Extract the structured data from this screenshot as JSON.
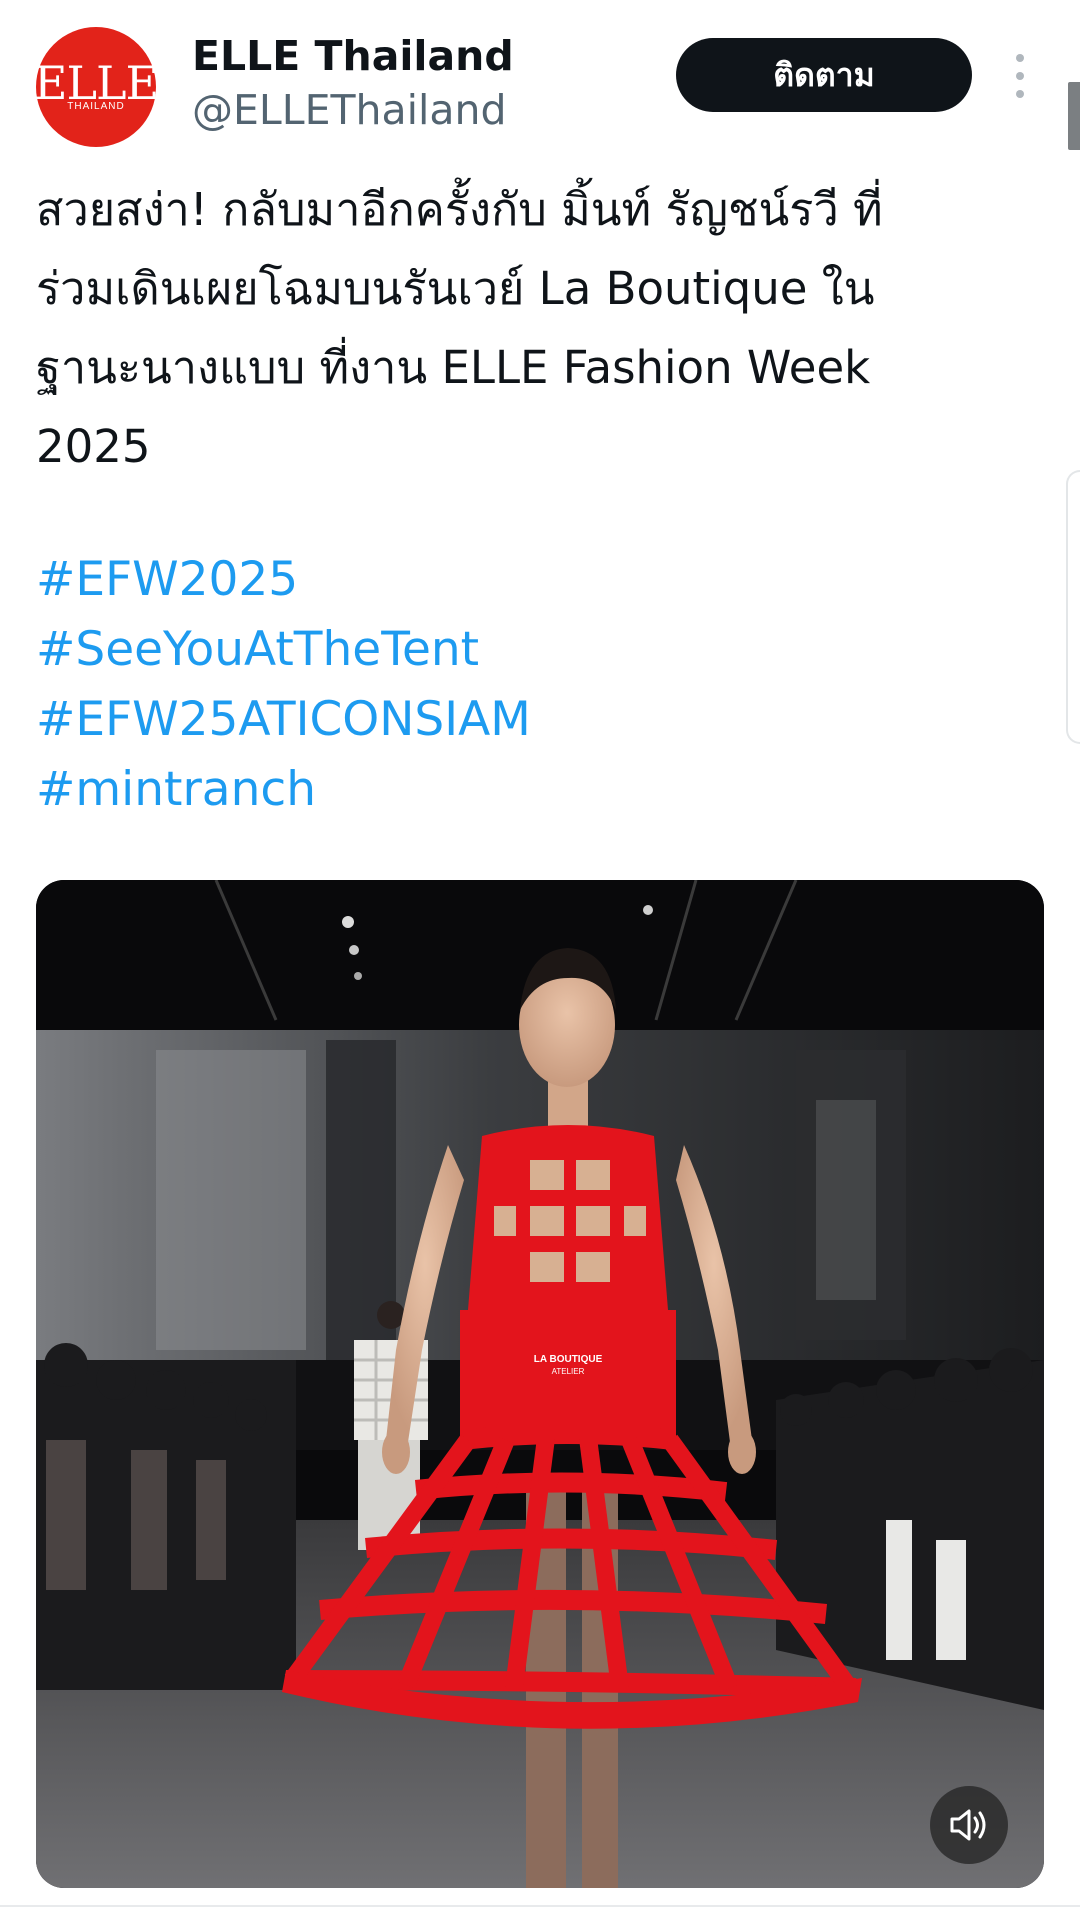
{
  "account": {
    "avatar_brand": "ELLE",
    "avatar_sub": "THAILAND",
    "display_name": "ELLE Thailand",
    "handle": "@ELLEThailand"
  },
  "follow_label": "ติดตาม",
  "tweet": {
    "lines": [
      "สวยสง่า! กลับมาอีกครั้งกับ มิ้นท์ รัญชน์รวี ที่",
      "ร่วมเดินเผยโฉมบนรันเวย์ La Boutique ใน",
      "ฐานะนางแบบ ที่งาน ELLE Fashion Week",
      "2025"
    ],
    "hashtags": [
      "#EFW2025",
      "#SeeYouAtTheTent",
      "#EFW25ATICONSIAM",
      "#mintranch"
    ]
  },
  "media": {
    "dress_label_line1": "LA BOUTIQUE",
    "dress_label_line2": "ATELIER",
    "volume_icon": "volume-icon"
  },
  "colors": {
    "avatar_red": "#e2231a",
    "link_blue": "#1d9bf0",
    "button_dark": "#0f1419",
    "dress_red": "#e3141c"
  }
}
